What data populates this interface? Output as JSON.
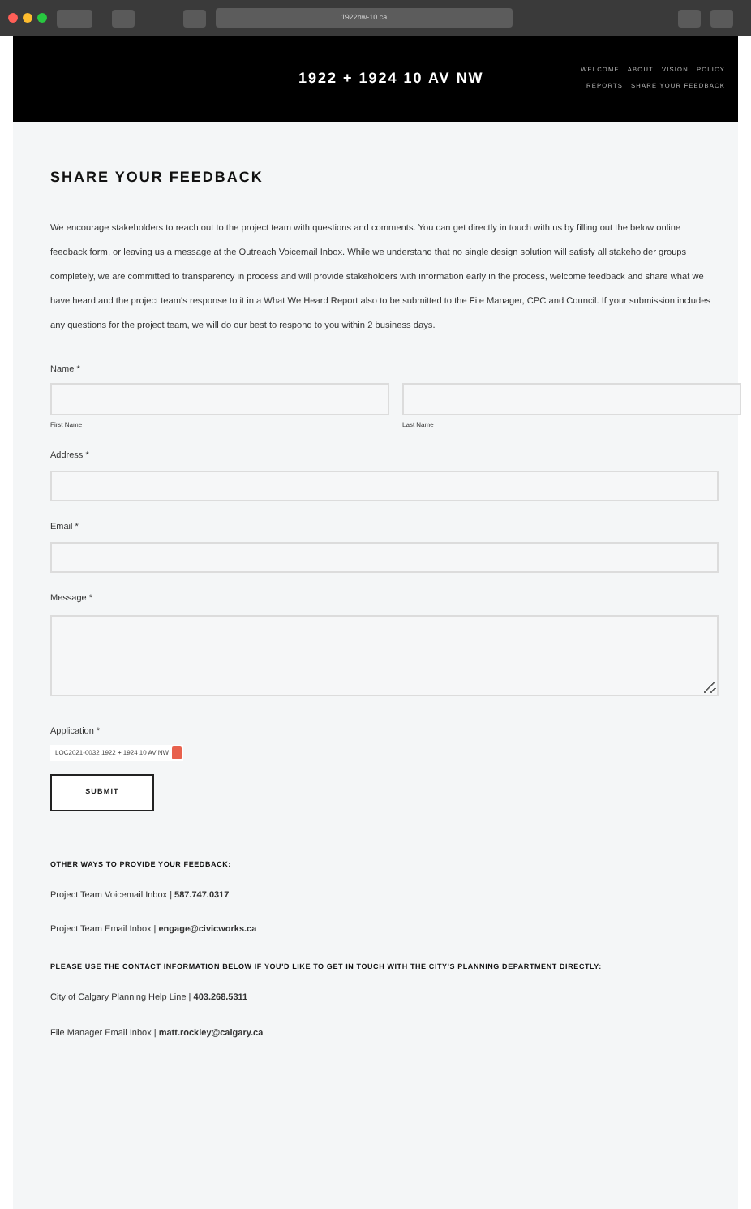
{
  "browser": {
    "url": "1922nw-10.ca"
  },
  "header": {
    "title": "1922 + 1924 10 AV NW",
    "nav": [
      [
        "WELCOME",
        "ABOUT",
        "VISION",
        "POLICY"
      ],
      [
        "REPORTS",
        "SHARE YOUR FEEDBACK"
      ]
    ]
  },
  "heading": "SHARE YOUR FEEDBACK",
  "intro": "We encourage stakeholders to reach out to the project team with questions and comments. You can get directly in touch with us by filling out the below online feedback form, or leaving us a message at the Outreach Voicemail Inbox. While we understand that no single design solution will satisfy all stakeholder groups completely, we are committed to transparency in process and will provide stakeholders with information early in the process, welcome feedback and share what we have heard and the project team's response to it in a What We Heard Report also to be submitted to the File Manager, CPC and Council. If your submission includes any questions for the project team, we will do our best to respond to you within 2 business days.",
  "form": {
    "name": {
      "label": "Name *",
      "first": "First Name",
      "last": "Last Name"
    },
    "fields": [
      {
        "label": "Address *",
        "kind": "text"
      },
      {
        "label": "Email *",
        "kind": "text"
      },
      {
        "label": "Message *",
        "kind": "textarea"
      }
    ],
    "application": {
      "label": "Application *",
      "value": "LOC2021-0032 1922 + 1924 10 AV NW"
    },
    "submit": "SUBMIT"
  },
  "sections": [
    {
      "heading": "OTHER WAYS TO PROVIDE YOUR FEEDBACK:",
      "lines": [
        "Project Team Voicemail Inbox | **587.747.0317**",
        "Project Team Email Inbox | **engage@civicworks.ca**"
      ]
    },
    {
      "heading": "PLEASE USE THE CONTACT INFORMATION BELOW IF YOU'D LIKE TO GET IN TOUCH WITH THE CITY'S PLANNING DEPARTMENT DIRECTLY:",
      "lines": [
        "City of Calgary Planning Help Line | **403.268.5311**",
        "File Manager Email Inbox | **matt.rockley@calgary.ca**"
      ]
    }
  ]
}
